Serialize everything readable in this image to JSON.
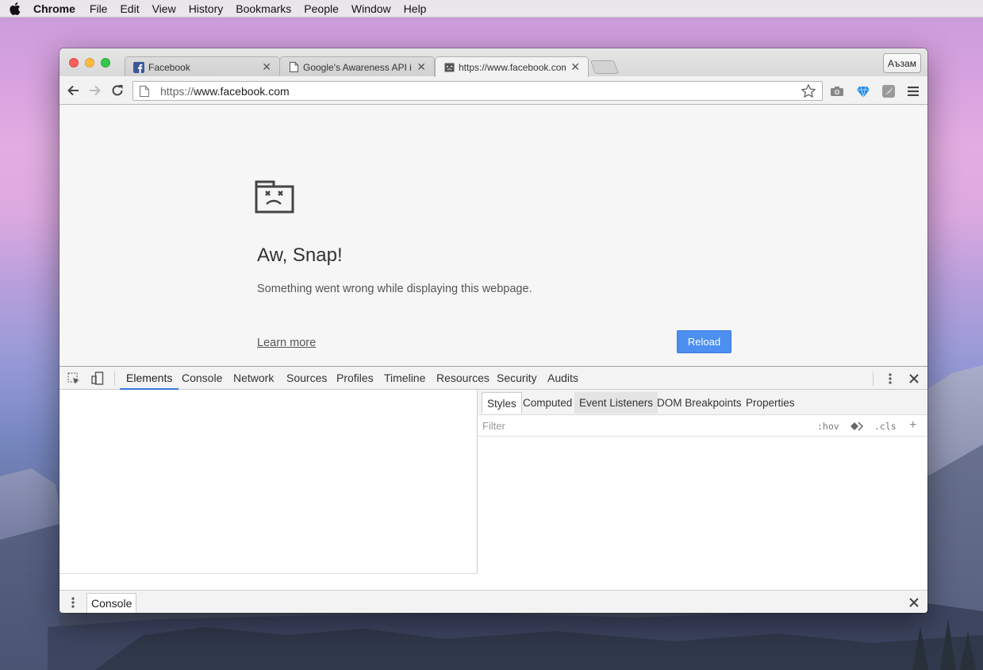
{
  "menubar": {
    "app": "Chrome",
    "items": [
      "File",
      "Edit",
      "View",
      "History",
      "Bookmarks",
      "People",
      "Window",
      "Help"
    ]
  },
  "window": {
    "tabs": [
      {
        "label": "Facebook",
        "icon": "facebook-icon"
      },
      {
        "label": "Google's Awareness API in",
        "icon": "page-icon"
      },
      {
        "label": "https://www.facebook.com",
        "icon": "sad-tab-icon"
      }
    ],
    "profile": "Аъзам",
    "url_scheme": "https://",
    "url_host": "www.facebook.com"
  },
  "error_page": {
    "title": "Aw, Snap!",
    "message": "Something went wrong while displaying this webpage.",
    "learn_more": "Learn more",
    "reload": "Reload"
  },
  "devtools": {
    "tabs": [
      "Elements",
      "Console",
      "Network",
      "Sources",
      "Profiles",
      "Timeline",
      "Resources",
      "Security",
      "Audits"
    ],
    "active_tab": "Elements",
    "sidebar_tabs": [
      "Styles",
      "Computed",
      "Event Listeners",
      "DOM Breakpoints",
      "Properties"
    ],
    "filter_placeholder": "Filter",
    "hov": ":hov",
    "cls": ".cls",
    "drawer_tab": "Console"
  },
  "colors": {
    "accent": "#4d8ff0",
    "active_tab_underline": "#3879d9"
  }
}
